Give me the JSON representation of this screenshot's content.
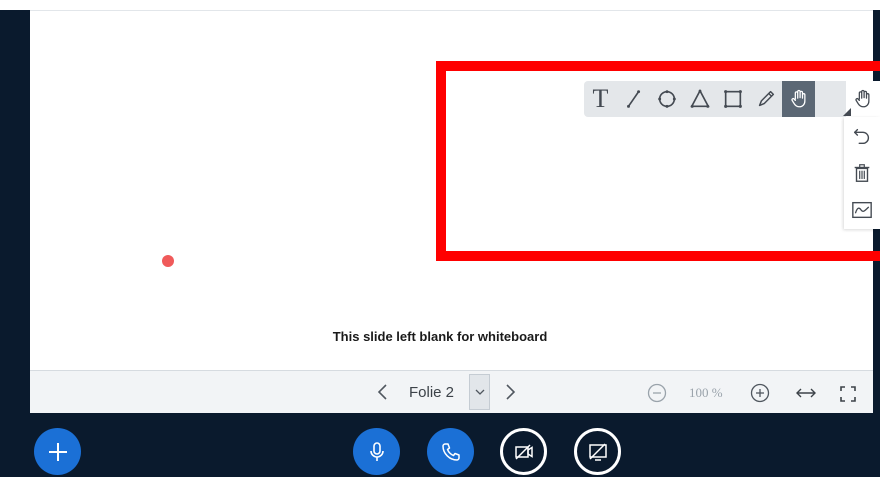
{
  "slide": {
    "caption": "This slide left blank for whiteboard"
  },
  "whiteboard_toolbar": {
    "tools": [
      {
        "name": "text-tool",
        "icon": "text-icon",
        "glyph": "T"
      },
      {
        "name": "line-tool",
        "icon": "line-icon"
      },
      {
        "name": "ellipse-tool",
        "icon": "ellipse-icon"
      },
      {
        "name": "triangle-tool",
        "icon": "triangle-icon"
      },
      {
        "name": "rectangle-tool",
        "icon": "rectangle-icon"
      },
      {
        "name": "pencil-tool",
        "icon": "pencil-icon"
      },
      {
        "name": "pan-tool",
        "icon": "hand-icon",
        "active": true
      }
    ],
    "side_tools": [
      "hand-icon",
      "undo-icon",
      "trash-icon",
      "multi-user-whiteboard-icon"
    ]
  },
  "navigation": {
    "slide_label": "Folie 2",
    "zoom_level": "100 %"
  },
  "action_bar": {
    "buttons": [
      "plus-icon",
      "microphone-icon",
      "phone-icon",
      "video-off-icon",
      "screenshare-off-icon"
    ]
  },
  "colors": {
    "highlight_border": "#ff0000",
    "accent_blue": "#1b70d6",
    "dark_background": "#0a1a2d",
    "cursor_dot": "#f05a5a",
    "active_tool": "#5b6774"
  }
}
